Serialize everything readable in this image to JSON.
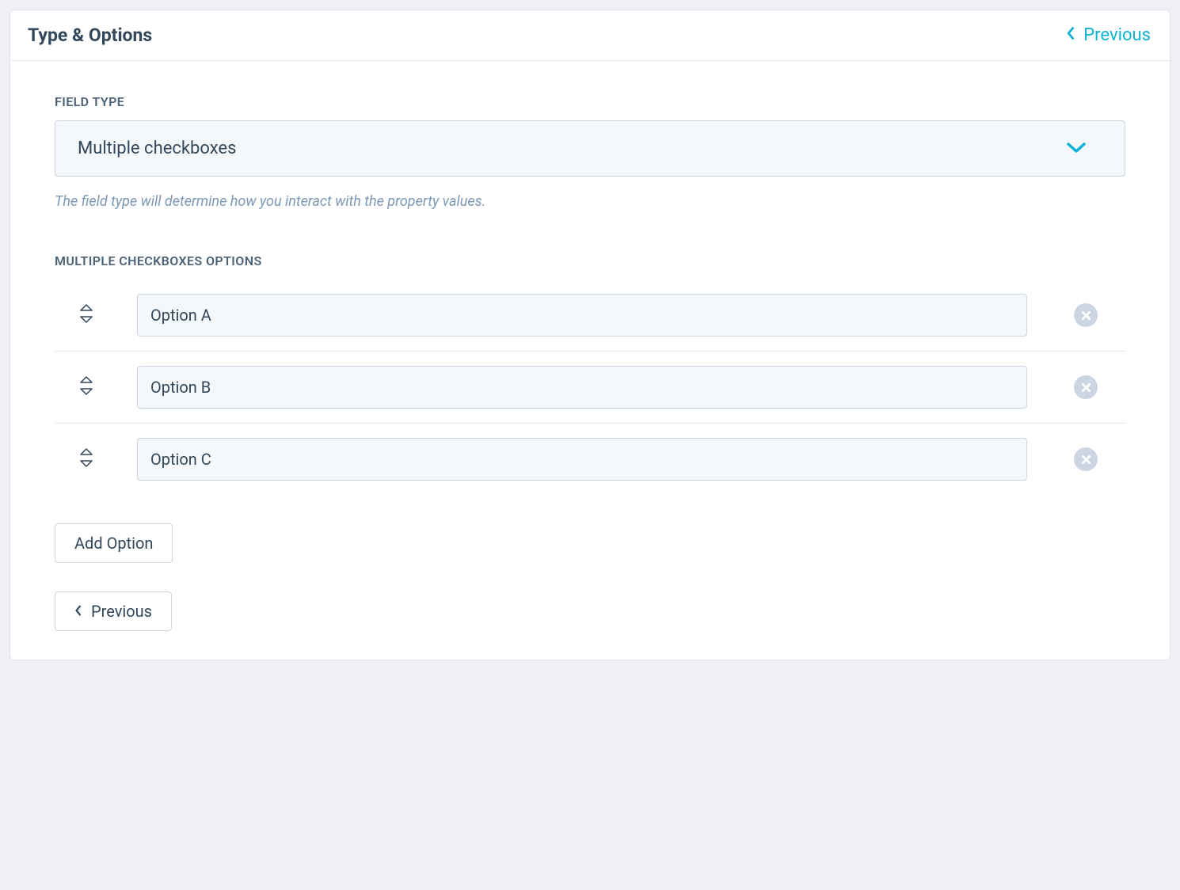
{
  "header": {
    "title": "Type & Options",
    "prev_label": "Previous"
  },
  "field_type": {
    "label": "FIELD TYPE",
    "selected": "Multiple checkboxes",
    "help": "The field type will determine how you interact with the property values."
  },
  "options_section": {
    "label": "MULTIPLE CHECKBOXES OPTIONS",
    "options": [
      {
        "value": "Option A"
      },
      {
        "value": "Option B"
      },
      {
        "value": "Option C"
      }
    ],
    "add_label": "Add Option"
  },
  "footer": {
    "prev_label": "Previous"
  }
}
